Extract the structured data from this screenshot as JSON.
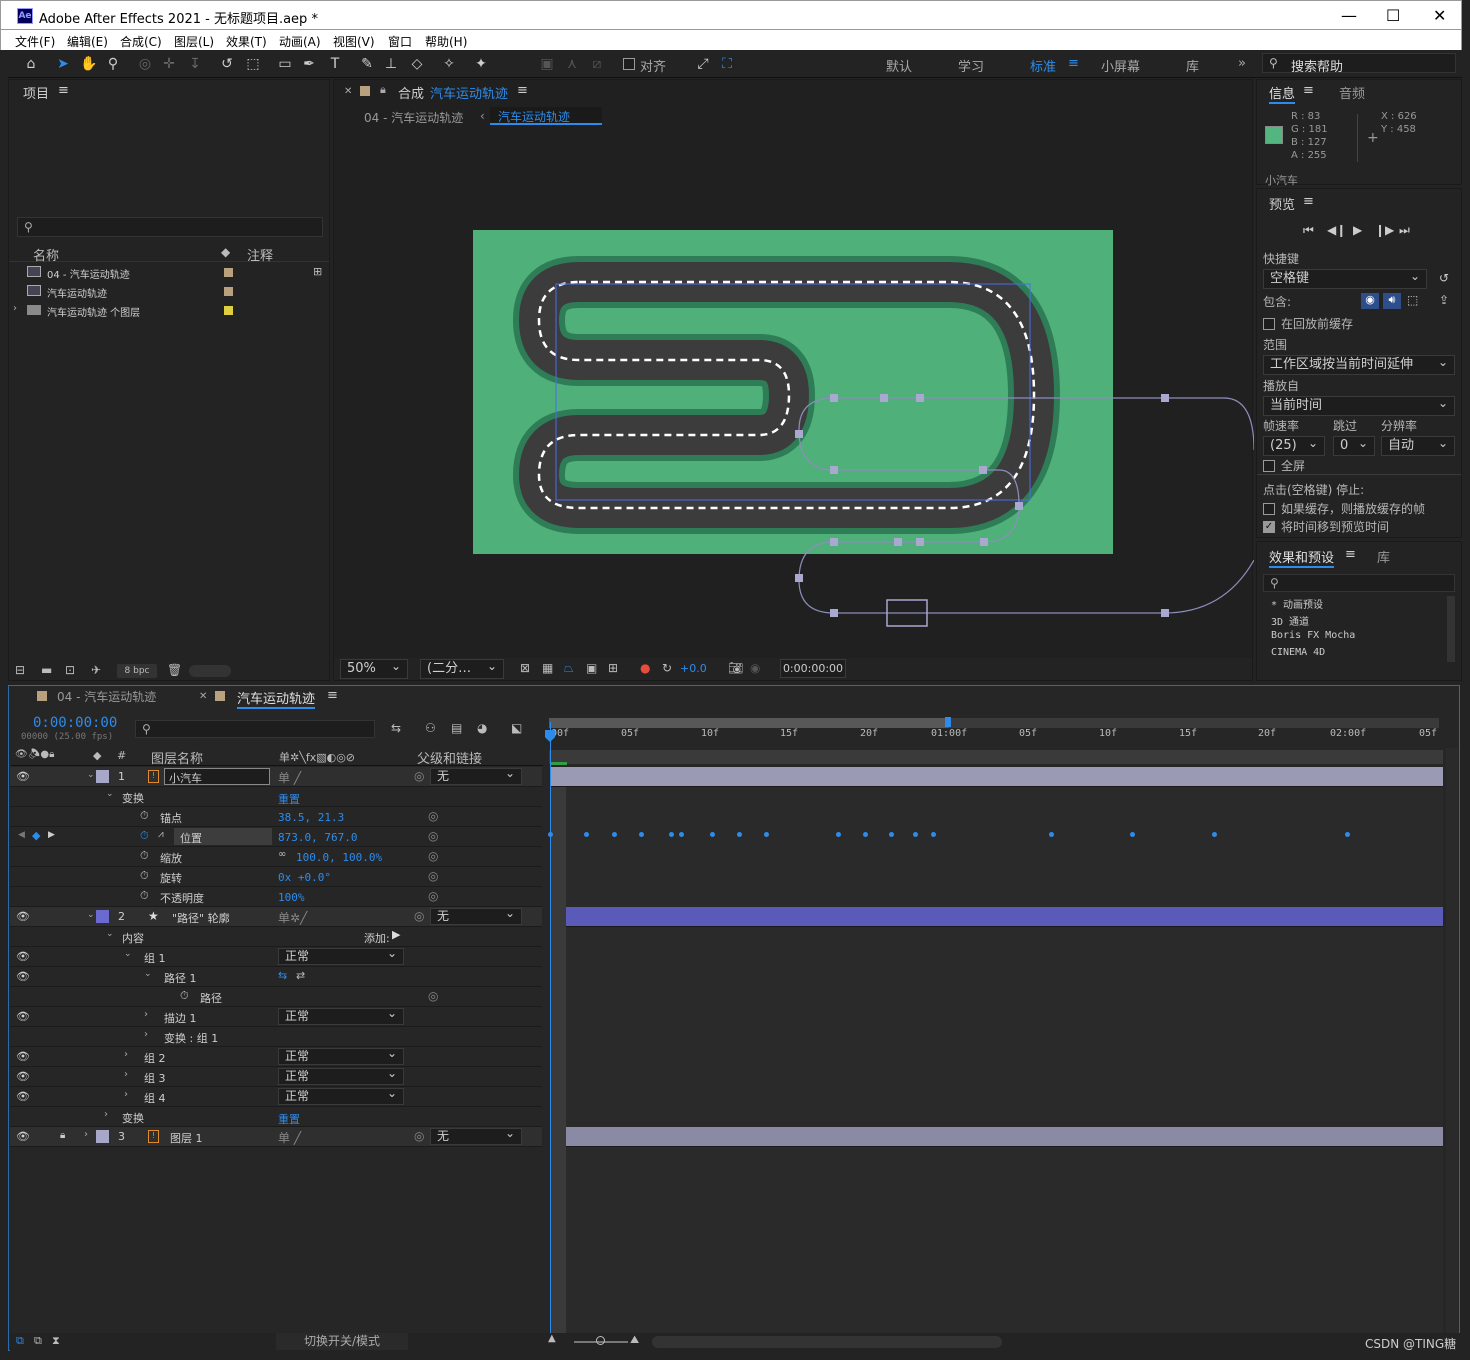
{
  "window": {
    "title": "Adobe After Effects 2021 - 无标题项目.aep *",
    "logo": "Ae",
    "minimize": "—",
    "maximize": "☐",
    "close": "✕"
  },
  "menu": [
    "文件(F)",
    "编辑(E)",
    "合成(C)",
    "图层(L)",
    "效果(T)",
    "动画(A)",
    "视图(V)",
    "窗口",
    "帮助(H)"
  ],
  "toolbar": {
    "snap_label": "对齐",
    "workspaces": [
      "默认",
      "学习",
      "标准",
      "小屏幕",
      "库"
    ],
    "active_workspace": "标准",
    "more": "»",
    "search_placeholder": "搜索帮助"
  },
  "project": {
    "title": "项目",
    "col_name": "名称",
    "col_comment": "注释",
    "items": [
      {
        "name": "04 - 汽车运动轨迹",
        "color": "#b8a17c"
      },
      {
        "name": "汽车运动轨迹",
        "color": "#b8a17c"
      },
      {
        "name": "汽车运动轨迹 个图层",
        "color": "#e0d040"
      }
    ],
    "bpc": "8 bpc"
  },
  "comp_viewer": {
    "tab_prefix": "合成",
    "tab_name": "汽车运动轨迹",
    "breadcrumb_parent": "04 - 汽车运动轨迹",
    "breadcrumb_current": "汽车运动轨迹",
    "zoom": "50%",
    "resolution": "(二分…",
    "exposure": "+0.0",
    "timecode": "0:00:00:00",
    "bg_color": "#4fb07a"
  },
  "info": {
    "tab_info": "信息",
    "tab_audio": "音频",
    "r": "R : 83",
    "g": "G : 181",
    "b": "B : 127",
    "a": "A : 255",
    "x": "X : 626",
    "y": "Y : 458",
    "swatch": "#53b57f",
    "layer": "小汽车"
  },
  "preview": {
    "title": "预览",
    "shortcut_label": "快捷键",
    "shortcut_value": "空格键",
    "include_label": "包含:",
    "cache_before": "在回放前缓存",
    "range_label": "范围",
    "range_value": "工作区域按当前时间延伸",
    "play_from_label": "播放自",
    "play_from_value": "当前时间",
    "fps_label": "帧速率",
    "skip_label": "跳过",
    "res_label": "分辨率",
    "fps_value": "(25)",
    "skip_value": "0",
    "res_value": "自动",
    "fullscreen": "全屏",
    "stop_label": "点击(空格键) 停止:",
    "stop_opt1": "如果缓存，则播放缓存的帧",
    "stop_opt2": "将时间移到预览时间"
  },
  "effects": {
    "tab": "效果和预设",
    "tab_lib": "库",
    "items": [
      "* 动画预设",
      "3D 通道",
      "Boris FX Mocha",
      "CINEMA 4D"
    ]
  },
  "timeline": {
    "tab1": "04 - 汽车运动轨迹",
    "tab2": "汽车运动轨迹",
    "timecode": "0:00:00:00",
    "frames": "00000 (25.00 fps)",
    "col_layer_name": "图层名称",
    "col_parent": "父级和链接",
    "ruler": [
      "00f",
      "05f",
      "10f",
      "15f",
      "20f",
      "01:00f",
      "05f",
      "10f",
      "15f",
      "20f",
      "02:00f",
      "05f"
    ],
    "toggle_label": "切换开关/模式",
    "rows": [
      {
        "num": "1",
        "name": "小汽车",
        "parent": "无"
      },
      {
        "prop": "变换",
        "value": "重置"
      },
      {
        "prop": "锚点",
        "value": "38.5, 21.3"
      },
      {
        "prop": "位置",
        "value": "873.0, 767.0"
      },
      {
        "prop": "缩放",
        "value": "100.0, 100.0%"
      },
      {
        "prop": "旋转",
        "value": "0x +0.0°"
      },
      {
        "prop": "不透明度",
        "value": "100%"
      },
      {
        "num": "2",
        "name": "\"路径\" 轮廓",
        "parent": "无"
      },
      {
        "prop": "内容",
        "value": "添加:"
      },
      {
        "prop": "组 1",
        "value": "正常"
      },
      {
        "prop": "路径 1",
        "value": ""
      },
      {
        "prop": "路径",
        "value": ""
      },
      {
        "prop": "描边 1",
        "value": "正常"
      },
      {
        "prop": "变换 : 组 1",
        "value": ""
      },
      {
        "prop": "组 2",
        "value": "正常"
      },
      {
        "prop": "组 3",
        "value": "正常"
      },
      {
        "prop": "组 4",
        "value": "正常"
      },
      {
        "prop": "变换",
        "value": "重置"
      },
      {
        "num": "3",
        "name": "图层 1",
        "parent": "无"
      }
    ]
  },
  "watermark": "CSDN @TING糖"
}
